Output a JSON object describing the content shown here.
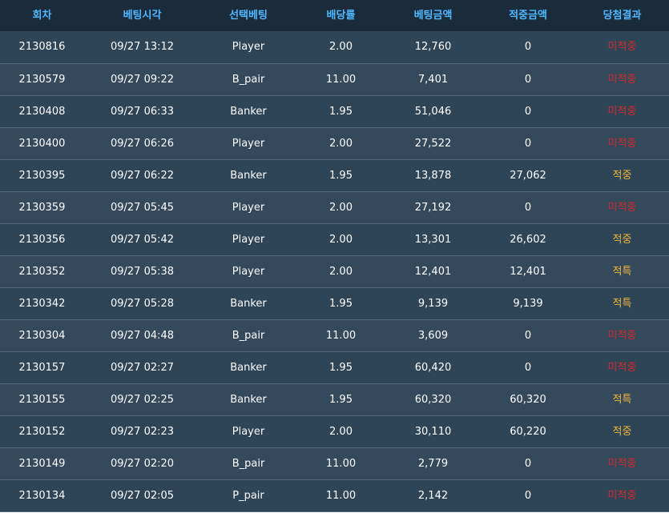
{
  "headers": [
    "회차",
    "베팅시각",
    "선택베팅",
    "배당률",
    "베팅금액",
    "적중금액",
    "당첨결과"
  ],
  "colors": {
    "header_bg": "#1a2b3b",
    "header_text": "#4fb8ff",
    "row_bg": "#2e4557",
    "row_text": "#ffffff",
    "lose": "#d32a2a",
    "win": "#f0b63a"
  },
  "rows": [
    {
      "round": "2130816",
      "time": "09/27 13:12",
      "bet": "Player",
      "odds": "2.00",
      "amount": "12,760",
      "win_amount": "0",
      "result": "미적중",
      "status": "lose"
    },
    {
      "round": "2130579",
      "time": "09/27 09:22",
      "bet": "B_pair",
      "odds": "11.00",
      "amount": "7,401",
      "win_amount": "0",
      "result": "미적중",
      "status": "lose"
    },
    {
      "round": "2130408",
      "time": "09/27 06:33",
      "bet": "Banker",
      "odds": "1.95",
      "amount": "51,046",
      "win_amount": "0",
      "result": "미적중",
      "status": "lose"
    },
    {
      "round": "2130400",
      "time": "09/27 06:26",
      "bet": "Player",
      "odds": "2.00",
      "amount": "27,522",
      "win_amount": "0",
      "result": "미적중",
      "status": "lose"
    },
    {
      "round": "2130395",
      "time": "09/27 06:22",
      "bet": "Banker",
      "odds": "1.95",
      "amount": "13,878",
      "win_amount": "27,062",
      "result": "적중",
      "status": "win"
    },
    {
      "round": "2130359",
      "time": "09/27 05:45",
      "bet": "Player",
      "odds": "2.00",
      "amount": "27,192",
      "win_amount": "0",
      "result": "미적중",
      "status": "lose"
    },
    {
      "round": "2130356",
      "time": "09/27 05:42",
      "bet": "Player",
      "odds": "2.00",
      "amount": "13,301",
      "win_amount": "26,602",
      "result": "적중",
      "status": "win"
    },
    {
      "round": "2130352",
      "time": "09/27 05:38",
      "bet": "Player",
      "odds": "2.00",
      "amount": "12,401",
      "win_amount": "12,401",
      "result": "적특",
      "status": "win"
    },
    {
      "round": "2130342",
      "time": "09/27 05:28",
      "bet": "Banker",
      "odds": "1.95",
      "amount": "9,139",
      "win_amount": "9,139",
      "result": "적특",
      "status": "win"
    },
    {
      "round": "2130304",
      "time": "09/27 04:48",
      "bet": "B_pair",
      "odds": "11.00",
      "amount": "3,609",
      "win_amount": "0",
      "result": "미적중",
      "status": "lose"
    },
    {
      "round": "2130157",
      "time": "09/27 02:27",
      "bet": "Banker",
      "odds": "1.95",
      "amount": "60,420",
      "win_amount": "0",
      "result": "미적중",
      "status": "lose"
    },
    {
      "round": "2130155",
      "time": "09/27 02:25",
      "bet": "Banker",
      "odds": "1.95",
      "amount": "60,320",
      "win_amount": "60,320",
      "result": "적특",
      "status": "win"
    },
    {
      "round": "2130152",
      "time": "09/27 02:23",
      "bet": "Player",
      "odds": "2.00",
      "amount": "30,110",
      "win_amount": "60,220",
      "result": "적중",
      "status": "win"
    },
    {
      "round": "2130149",
      "time": "09/27 02:20",
      "bet": "B_pair",
      "odds": "11.00",
      "amount": "2,779",
      "win_amount": "0",
      "result": "미적중",
      "status": "lose"
    },
    {
      "round": "2130134",
      "time": "09/27 02:05",
      "bet": "P_pair",
      "odds": "11.00",
      "amount": "2,142",
      "win_amount": "0",
      "result": "미적중",
      "status": "lose"
    }
  ]
}
